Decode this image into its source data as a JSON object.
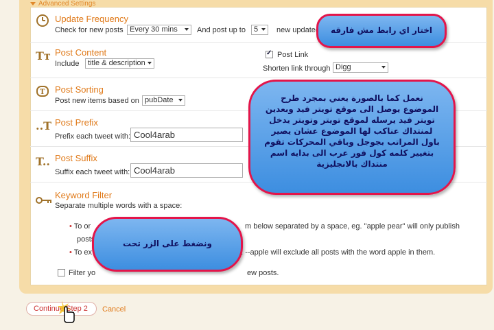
{
  "advanced_settings": "Advanced Settings",
  "update_frequency": {
    "title": "Update Frequency",
    "check_label": "Check for new posts",
    "check_value": "Every 30 mins",
    "and_post_label": "And post up to",
    "post_up_to_value": "5",
    "new_updates_label": "new update(s"
  },
  "post_content": {
    "title": "Post Content",
    "include_label": "Include",
    "include_value": "title & description",
    "post_link_label": "Post Link",
    "shorten_label": "Shorten link through",
    "shorten_value": "Digg"
  },
  "post_sorting": {
    "title": "Post Sorting",
    "label": "Post new items based on",
    "value": "pubDate"
  },
  "post_prefix": {
    "title": "Post Prefix",
    "label": "Prefix each tweet with:",
    "value": "Cool4arab"
  },
  "post_suffix": {
    "title": "Post Suffix",
    "label": "Suffix each tweet with:",
    "value": "Cool4arab",
    "trailing": "("
  },
  "keyword_filter": {
    "title": "Keyword Filter",
    "desc": "Separate multiple words with a space:",
    "bullet1_start": "To or",
    "bullet1_end": "m below separated by a space, eg. \"apple pear\" will only publish",
    "bullet1_line2": "posts",
    "bullet2_start": "To ex",
    "bullet2_end": "g. --apple will exclude all posts with the word apple in them.",
    "filter_start": "Filter yo",
    "filter_end": "ew posts."
  },
  "buttons": {
    "continue": "Continue",
    "step2": "Step 2",
    "cancel": "Cancel"
  },
  "bubbles": {
    "top": "اختار اي رابط مش فارقه",
    "middle": "نعمل كما بالصورة يعني بمجرد طرح الموضوع يوصل الى موقع تويتر فيد وبعدين تويتر فيد يرسله لموقع تويتر وتويتر يدخل لمنتداك عناكب لها الموضوع عشان يصير باول المراتب بجوجل وباقي المحركات تقوم بتغيير كلمه كول فور عرب الى بدايه اسم منتداك بالانجليزية",
    "bottom": "ونضغط على الزر تحت"
  },
  "colors": {
    "accent": "#e07a1a",
    "panel": "#f6dca8",
    "bubble_border": "#e3154a"
  }
}
